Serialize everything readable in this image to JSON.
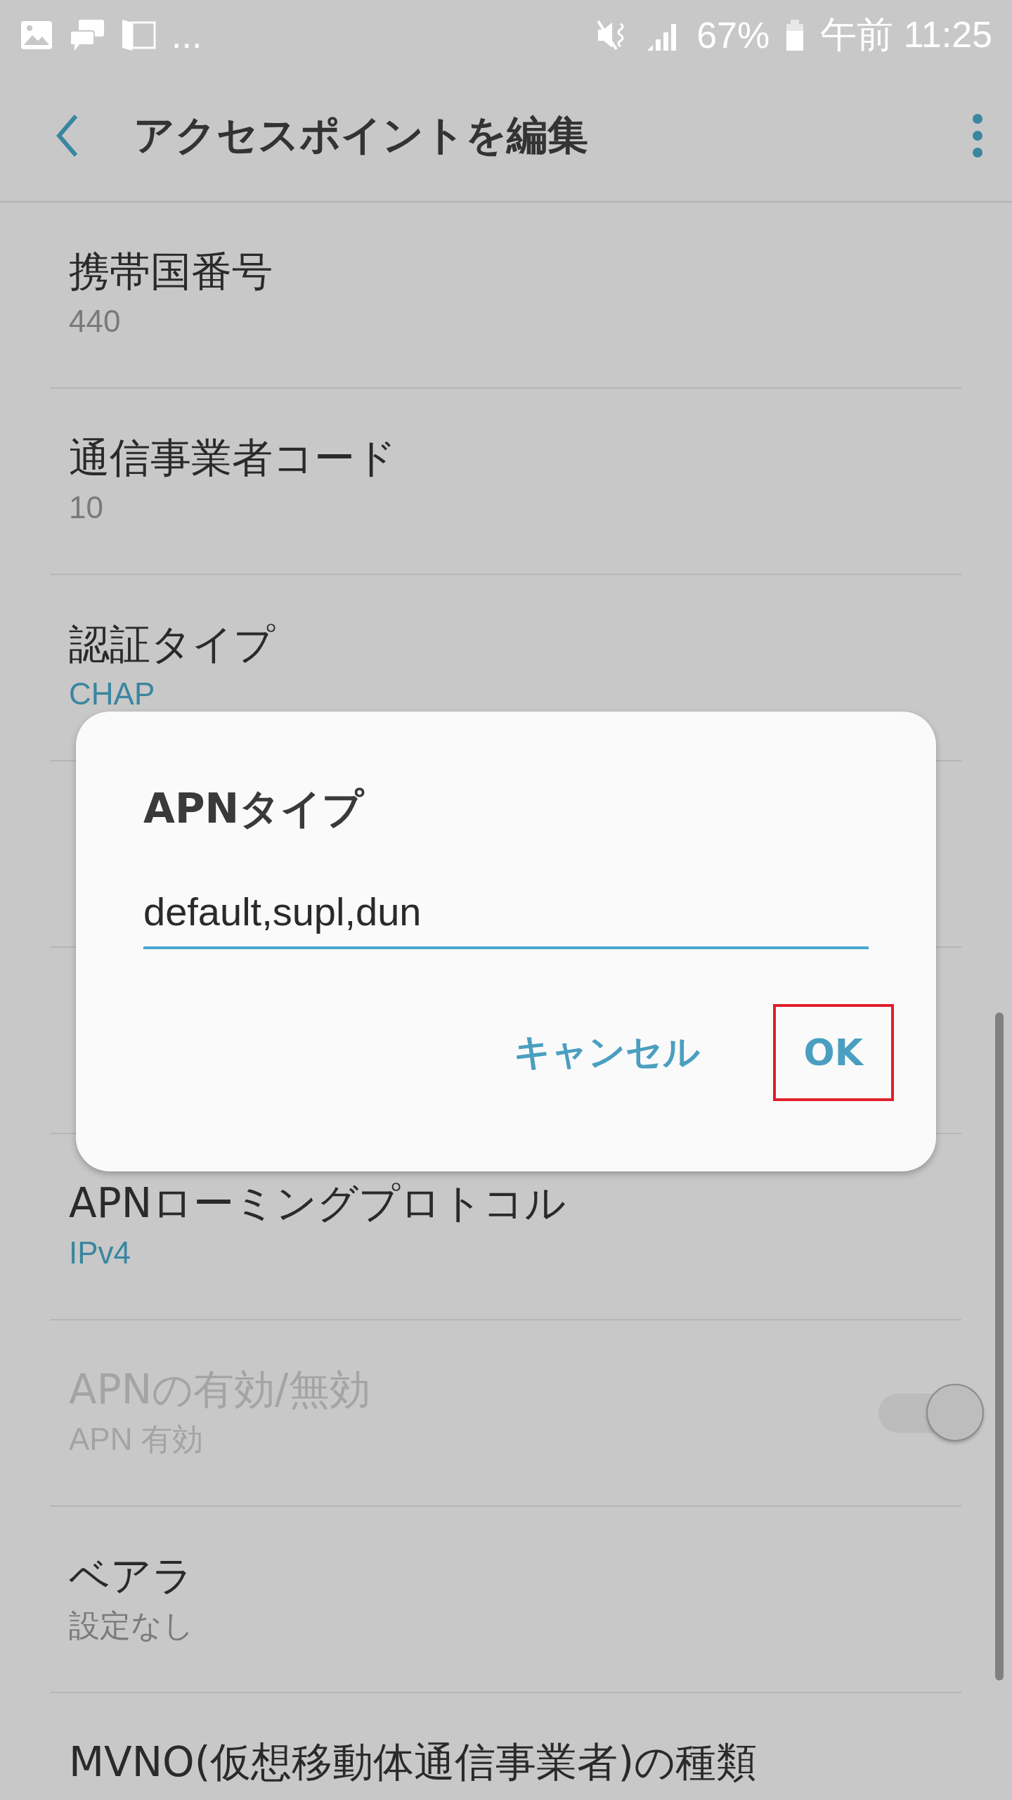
{
  "status_bar": {
    "overflow": "...",
    "battery_percent": "67%",
    "time": "午前 11:25"
  },
  "app_bar": {
    "title": "アクセスポイントを編集"
  },
  "settings_above": [
    {
      "kind": "value",
      "title": "携帯国番号",
      "value": "440",
      "accent": false
    },
    {
      "kind": "value",
      "title": "通信事業者コード",
      "value": "10",
      "accent": false
    },
    {
      "kind": "value",
      "title": "認証タイプ",
      "value": "CHAP",
      "accent": true
    }
  ],
  "settings_below": [
    {
      "kind": "value",
      "title": "APNローミングプロトコル",
      "value": "IPv4",
      "accent": true
    },
    {
      "kind": "switch",
      "title": "APNの有効/無効",
      "value": "APN 有効",
      "disabled": true,
      "on": true
    },
    {
      "kind": "value",
      "title": "ベアラ",
      "value": "設定なし",
      "accent": false
    },
    {
      "kind": "value",
      "title": "MVNO(仮想移動体通信事業者)の種類"
    }
  ],
  "dialog": {
    "title": "APNタイプ",
    "input_value": "default,supl,dun",
    "buttons": [
      {
        "label": "キャンセル",
        "highlighted": false
      },
      {
        "label": "OK",
        "highlighted": true
      }
    ]
  }
}
